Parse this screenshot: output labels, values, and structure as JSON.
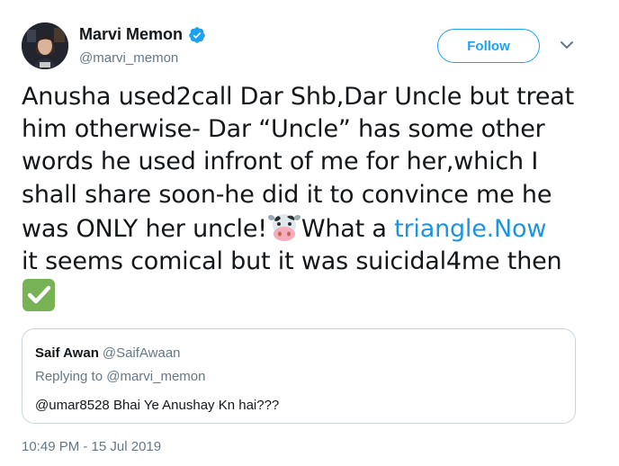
{
  "author": {
    "display_name": "Marvi Memon",
    "handle": "@marvi_memon",
    "verified": true
  },
  "follow_label": "Follow",
  "tweet": {
    "lines": [
      "Anusha used2call Dar Shb,Dar Uncle but treat",
      "him otherwise- Dar “Uncle” has some other",
      "words he used infront of me for her,which I",
      "shall share soon-he did it to convince me he"
    ],
    "line5_before_emoji": "was ONLY her uncle!",
    "line5_after_emoji": "What a ",
    "line5_link": "triangle.Now",
    "line6": "it seems comical but it was suicidal4me then",
    "emojis": [
      "cow-face",
      "check-mark"
    ]
  },
  "quote": {
    "name": "Saif Awan",
    "handle": "@SaifAwaan",
    "replying_label": "Replying to",
    "replying_handle": "@marvi_memon",
    "text": "@umar8528 Bhai Ye Anushay Kn hai???"
  },
  "timestamp": "10:49 PM - 15 Jul 2019",
  "colors": {
    "accent": "#1da1f2",
    "link": "#1b95e0",
    "secondary_text": "#657786",
    "border": "#ccd6dd"
  }
}
